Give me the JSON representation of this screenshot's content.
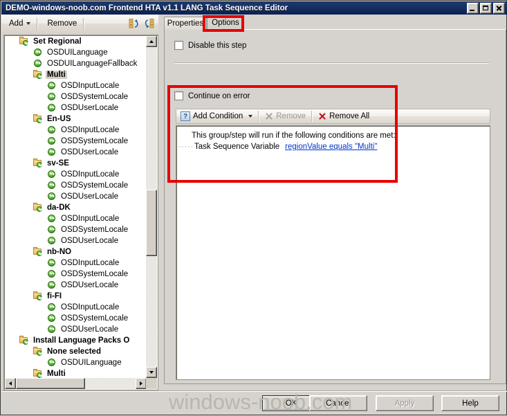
{
  "window": {
    "title": "DEMO-windows-noob.com Frontend HTA v1.1 LANG Task Sequence Editor",
    "minimize_label": "Minimize",
    "maximize_label": "Maximize",
    "close_label": "Close"
  },
  "toolbar": {
    "add_label": "Add",
    "remove_label": "Remove",
    "icon1": "collapse-all-icon",
    "icon2": "expand-all-icon"
  },
  "tabs": [
    {
      "label": "Properties",
      "active": false
    },
    {
      "label": "Options",
      "active": true
    }
  ],
  "options": {
    "disable_step_label": "Disable this step",
    "disable_step_checked": false,
    "continue_on_error_label": "Continue on error",
    "continue_on_error_checked": false
  },
  "condition_toolbar": {
    "add_condition_label": "Add Condition",
    "remove_label": "Remove",
    "remove_disabled": true,
    "remove_all_label": "Remove All",
    "remove_all_disabled": false
  },
  "condition_list": {
    "header": "This group/step will run if the following conditions are met:",
    "dots": "·····",
    "item_prefix": "Task Sequence Variable",
    "item_link": "regionValue equals \"Multi\""
  },
  "tree": [
    {
      "label": "Set Regional",
      "type": "folder",
      "depth": 1,
      "selected": false
    },
    {
      "label": "OSDUILanguage",
      "type": "step",
      "depth": 2,
      "selected": false
    },
    {
      "label": "OSDUILanguageFallback",
      "type": "step",
      "depth": 2,
      "selected": false
    },
    {
      "label": "Multi",
      "type": "folder",
      "depth": 2,
      "selected": true
    },
    {
      "label": "OSDInputLocale",
      "type": "step",
      "depth": 3,
      "selected": false
    },
    {
      "label": "OSDSystemLocale",
      "type": "step",
      "depth": 3,
      "selected": false
    },
    {
      "label": "OSDUserLocale",
      "type": "step",
      "depth": 3,
      "selected": false
    },
    {
      "label": "En-US",
      "type": "folder",
      "depth": 2,
      "selected": false
    },
    {
      "label": "OSDInputLocale",
      "type": "step",
      "depth": 3,
      "selected": false
    },
    {
      "label": "OSDSystemLocale",
      "type": "step",
      "depth": 3,
      "selected": false
    },
    {
      "label": "OSDUserLocale",
      "type": "step",
      "depth": 3,
      "selected": false
    },
    {
      "label": "sv-SE",
      "type": "folder",
      "depth": 2,
      "selected": false
    },
    {
      "label": "OSDInputLocale",
      "type": "step",
      "depth": 3,
      "selected": false
    },
    {
      "label": "OSDSystemLocale",
      "type": "step",
      "depth": 3,
      "selected": false
    },
    {
      "label": "OSDUserLocale",
      "type": "step",
      "depth": 3,
      "selected": false
    },
    {
      "label": "da-DK",
      "type": "folder",
      "depth": 2,
      "selected": false
    },
    {
      "label": "OSDInputLocale",
      "type": "step",
      "depth": 3,
      "selected": false
    },
    {
      "label": "OSDSystemLocale",
      "type": "step",
      "depth": 3,
      "selected": false
    },
    {
      "label": "OSDUserLocale",
      "type": "step",
      "depth": 3,
      "selected": false
    },
    {
      "label": "nb-NO",
      "type": "folder",
      "depth": 2,
      "selected": false
    },
    {
      "label": "OSDInputLocale",
      "type": "step",
      "depth": 3,
      "selected": false
    },
    {
      "label": "OSDSystemLocale",
      "type": "step",
      "depth": 3,
      "selected": false
    },
    {
      "label": "OSDUserLocale",
      "type": "step",
      "depth": 3,
      "selected": false
    },
    {
      "label": "fi-FI",
      "type": "folder",
      "depth": 2,
      "selected": false
    },
    {
      "label": "OSDInputLocale",
      "type": "step",
      "depth": 3,
      "selected": false
    },
    {
      "label": "OSDSystemLocale",
      "type": "step",
      "depth": 3,
      "selected": false
    },
    {
      "label": "OSDUserLocale",
      "type": "step",
      "depth": 3,
      "selected": false
    },
    {
      "label": "Install Language Packs O",
      "type": "folder",
      "depth": 1,
      "selected": false
    },
    {
      "label": "None selected",
      "type": "folder",
      "depth": 2,
      "selected": false
    },
    {
      "label": "OSDUILanguage",
      "type": "step",
      "depth": 3,
      "selected": false
    },
    {
      "label": "Multi",
      "type": "folder",
      "depth": 2,
      "selected": false
    }
  ],
  "buttons": {
    "ok": "OK",
    "cancel": "Cancel",
    "apply": "Apply",
    "apply_disabled": true,
    "help": "Help"
  },
  "watermark": "windows-noob.com",
  "colors": {
    "titlebar": "#153064",
    "face": "#d6d3ce",
    "annotation": "#e60000",
    "link": "#0033cc",
    "folder": "#e8bc5e",
    "step_green": "#41a024"
  }
}
